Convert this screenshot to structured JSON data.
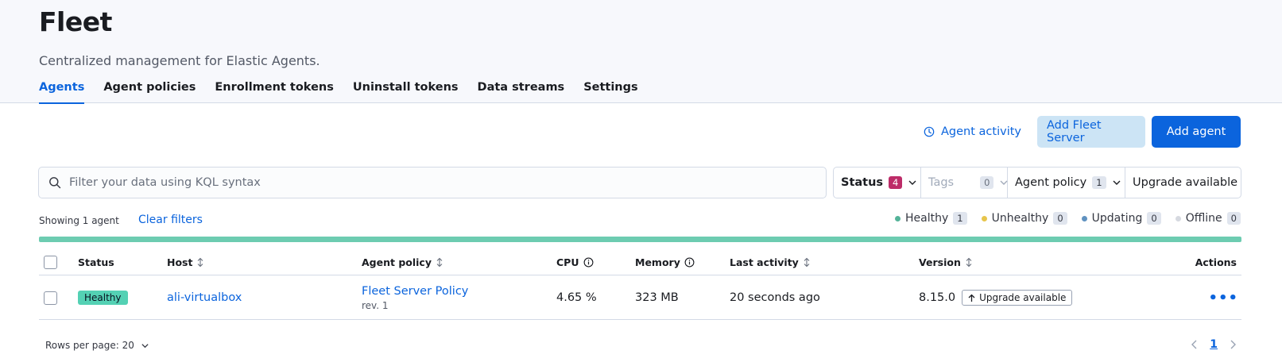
{
  "header": {
    "title": "Fleet",
    "subtitle": "Centralized management for Elastic Agents."
  },
  "tabs": [
    {
      "label": "Agents",
      "selected": true
    },
    {
      "label": "Agent policies"
    },
    {
      "label": "Enrollment tokens"
    },
    {
      "label": "Uninstall tokens"
    },
    {
      "label": "Data streams"
    },
    {
      "label": "Settings"
    }
  ],
  "actions": {
    "agent_activity_label": "Agent activity",
    "add_fleet_server_label": "Add Fleet Server",
    "add_agent_label": "Add agent"
  },
  "search": {
    "placeholder": "Filter your data using KQL syntax",
    "value": ""
  },
  "filters": {
    "status": {
      "label": "Status",
      "count": "4"
    },
    "tags": {
      "label": "Tags",
      "count": "0"
    },
    "agent_policy": {
      "label": "Agent policy",
      "count": "1"
    },
    "upgrade_available": {
      "label": "Upgrade available"
    }
  },
  "summary": {
    "showing": "Showing 1 agent",
    "clear_filters": "Clear filters"
  },
  "legend": [
    {
      "label": "Healthy",
      "count": "1",
      "color": "#54b399"
    },
    {
      "label": "Unhealthy",
      "count": "0",
      "color": "#e7c54c"
    },
    {
      "label": "Updating",
      "count": "0",
      "color": "#6092c0"
    },
    {
      "label": "Offline",
      "count": "0",
      "color": "#d6d9e0"
    }
  ],
  "colors": {
    "accent": "#0b64dd",
    "status_bar_healthy": "#6dccb1",
    "healthy_badge": "#54d1b4",
    "status_count_badge": "#bd2c68"
  },
  "table": {
    "columns": {
      "status": "Status",
      "host": "Host",
      "agent_policy": "Agent policy",
      "cpu": "CPU",
      "memory": "Memory",
      "last_activity": "Last activity",
      "version": "Version",
      "actions": "Actions"
    },
    "rows": [
      {
        "status": "Healthy",
        "host": "ali-virtualbox",
        "policy_name": "Fleet Server Policy",
        "policy_rev": "rev. 1",
        "cpu": "4.65 %",
        "memory": "323 MB",
        "last_activity": "20 seconds ago",
        "version": "8.15.0",
        "upgrade_label": "Upgrade available",
        "actions_icon": "ellipsis-icon"
      }
    ]
  },
  "pagination": {
    "rows_per_page": "Rows per page: 20",
    "current_page": "1"
  }
}
